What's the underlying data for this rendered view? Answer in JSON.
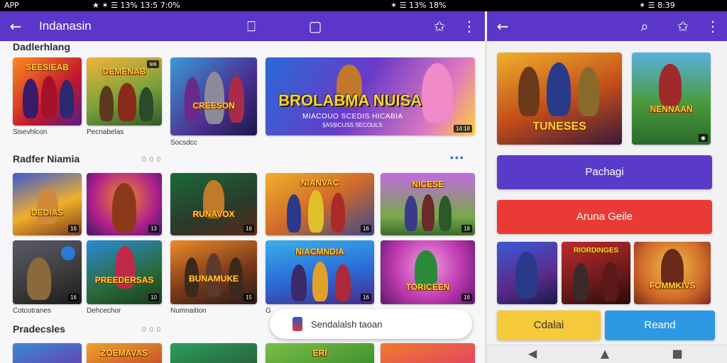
{
  "status_bar": {
    "left_label": "APP",
    "seg_a": "★ ✶ ☰ 13%  13:5 7:0%",
    "seg_b": "✶ ☰ 13%  18%",
    "seg_c": "✶ ☰ 8:39"
  },
  "left_appbar": {
    "title": "Indanasin",
    "back_icon": "←",
    "bookmark_icon": "⎕",
    "square_icon": "▢",
    "star_icon": "✩",
    "menu_icon": "⋮"
  },
  "right_appbar": {
    "back_icon": "←",
    "search_icon": "⌕",
    "star_icon": "✩",
    "menu_icon": "⋮"
  },
  "sections": [
    {
      "title": "Dadlerhlang"
    },
    {
      "title": "Radfer Niamia",
      "more": "0 0 0",
      "dots": "•••"
    },
    {
      "title": "Pradecsles",
      "more": "0 0 0"
    }
  ],
  "row1": {
    "tiles": [
      {
        "name": "SEESIEAB",
        "caption": "Sisevhlcon"
      },
      {
        "name": "DEMENAB",
        "badge": "tek",
        "caption": "Pecnabelas"
      },
      {
        "name": "CREESON",
        "caption": "Socsdcc"
      }
    ],
    "banner": {
      "title": "BROLABMA NUISA",
      "subtitle": "MIACOUO SCEDIS HICABIA",
      "subtitle2": "§AS§ICUSS SECOULS",
      "badge": "14:18"
    }
  },
  "row2": {
    "tiles": [
      {
        "name": "DEDIAS",
        "badge": "16"
      },
      {
        "name": "",
        "badge": "13"
      },
      {
        "name": "RUNAVOX",
        "badge": "16"
      },
      {
        "name": "NIANVAC",
        "badge": "16"
      },
      {
        "name": "NICESE",
        "badge": "18"
      }
    ]
  },
  "row3": {
    "tiles": [
      {
        "name": "",
        "badge": "16",
        "caption": "Cotcotranes"
      },
      {
        "name": "PREEDERSAS",
        "badge": "10",
        "caption": "Dehcechor"
      },
      {
        "name": "BUNAMUKE",
        "badge": "15",
        "caption": "Numnaition"
      },
      {
        "name": "NIACMNDIA",
        "badge": "16",
        "caption": "G"
      },
      {
        "name": "TORICEEN",
        "badge": "16"
      }
    ]
  },
  "row4": {
    "tiles": [
      {
        "name": ""
      },
      {
        "name": "ZOEMAVAS"
      },
      {
        "name": ""
      },
      {
        "name": "ERI"
      },
      {
        "name": ""
      }
    ]
  },
  "toast": {
    "label": "Sendalalsh taoan"
  },
  "right_pane": {
    "top_tiles": [
      {
        "name": "TUNESES",
        "badge": ""
      },
      {
        "name": "NENNAAN",
        "badge": "◉"
      }
    ],
    "button_primary": "Pachagi",
    "button_danger": "Aruna Geile",
    "small_tiles": [
      {
        "name": ""
      },
      {
        "name": "RIORDINGES"
      },
      {
        "name": "FOMMKIVS"
      }
    ],
    "button_yellow": "Cdalai",
    "button_blue": "Reand"
  },
  "nav": {
    "back": "◀",
    "home": "▲",
    "recent": "■"
  },
  "colors": {
    "appbar": "#5b36c9",
    "button_primary": "#5a3bc9",
    "button_danger": "#ea3a36",
    "button_yellow": "#f6c93a",
    "button_blue": "#2d98e4"
  }
}
